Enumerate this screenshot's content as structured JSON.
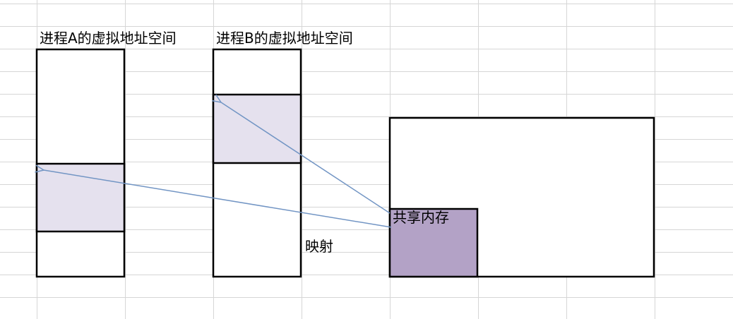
{
  "labels": {
    "process_a": "进程A的虚拟地址空间",
    "process_b": "进程B的虚拟地址空间",
    "shared_memory": "共享内存",
    "mapping": "映射"
  },
  "colors": {
    "gridline": "#d6d6d6",
    "box_border": "#000000",
    "mapped_region_fill": "#e5e1ee",
    "shared_memory_fill": "#b3a2c6",
    "arrow": "#7295c4"
  }
}
